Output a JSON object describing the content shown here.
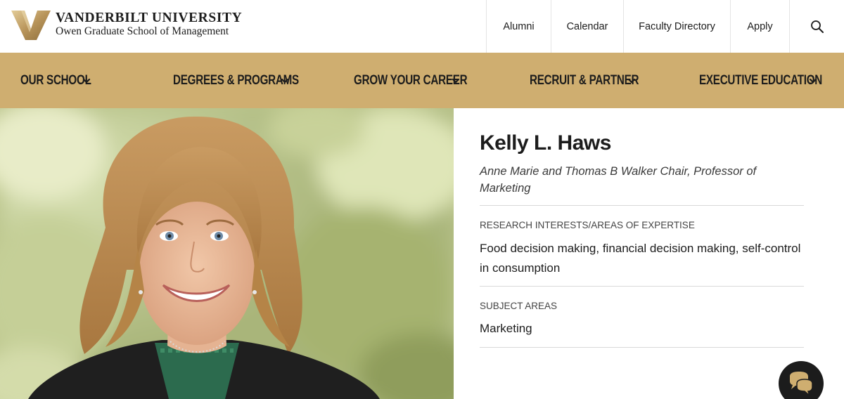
{
  "brand": {
    "university": "VANDERBILT UNIVERSITY",
    "school": "Owen Graduate School of Management",
    "gold": "#cfae70"
  },
  "utility_nav": {
    "items": [
      {
        "label": "Alumni"
      },
      {
        "label": "Calendar"
      },
      {
        "label": "Faculty Directory"
      },
      {
        "label": "Apply"
      }
    ],
    "search_icon": "search-icon"
  },
  "main_nav": {
    "items": [
      {
        "label": "OUR SCHOOL",
        "icon": "chevron-down-icon"
      },
      {
        "label": "DEGREES & PROGRAMS",
        "icon": "chevron-down-icon"
      },
      {
        "label": "GROW YOUR CAREER",
        "icon": "chevron-down-icon"
      },
      {
        "label": "RECRUIT & PARTNER",
        "icon": "chevron-down-icon"
      },
      {
        "label": "EXECUTIVE EDUCATION",
        "icon": "chevron-down-icon"
      }
    ]
  },
  "profile": {
    "name": "Kelly L. Haws",
    "title": "Anne Marie and Thomas B Walker Chair, Professor of Marketing",
    "sections": [
      {
        "label": "RESEARCH INTERESTS/AREAS OF EXPERTISE",
        "value": "Food decision making, financial decision making, self-control in consumption"
      },
      {
        "label": "SUBJECT AREAS",
        "value": "Marketing"
      }
    ]
  },
  "chat": {
    "icon": "chat-bubbles-icon"
  }
}
